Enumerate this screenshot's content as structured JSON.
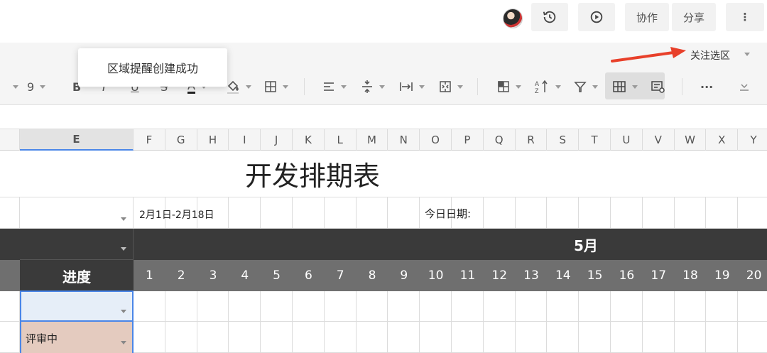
{
  "topbar": {
    "collab_label": "协作",
    "share_label": "分享",
    "more_label": "⋮"
  },
  "focus_area": {
    "label": "关注选区"
  },
  "toast": {
    "text": "区域提醒创建成功"
  },
  "toolbar": {
    "font_size": "9",
    "more_label": "···"
  },
  "columns": [
    "E",
    "F",
    "G",
    "H",
    "I",
    "J",
    "K",
    "L",
    "M",
    "N",
    "O",
    "P",
    "Q",
    "R",
    "S",
    "T",
    "U",
    "V",
    "W",
    "X",
    "Y"
  ],
  "sheet": {
    "title": "开发排期表",
    "date_range": "2月1日-2月18日",
    "today_label": "今日日期:",
    "month": "5月",
    "progress_header": "进度",
    "days": [
      "1",
      "2",
      "3",
      "4",
      "5",
      "6",
      "7",
      "8",
      "9",
      "10",
      "11",
      "12",
      "13",
      "14",
      "15",
      "16",
      "17",
      "18",
      "19",
      "20"
    ],
    "status_value": "评审中"
  },
  "colors": {
    "selection": "#4a86e8",
    "header_dark": "#3a3a3a",
    "day_row": "#6f6f6f",
    "status_fill": "#e4cbbf",
    "arrow": "#e8402a"
  }
}
